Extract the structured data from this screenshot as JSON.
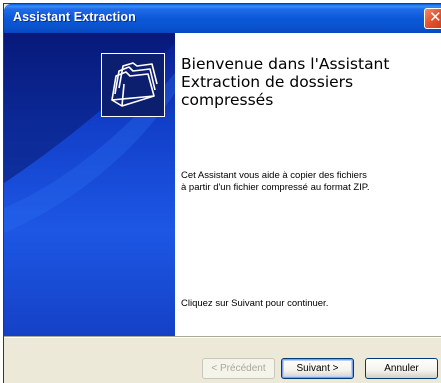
{
  "window": {
    "title": "Assistant Extraction",
    "close_icon": "close-icon"
  },
  "banner": {
    "icon": "compressed-folder-icon"
  },
  "content": {
    "heading": "Bienvenue dans l'Assistant Extraction de dossiers compressés",
    "description": "Cet Assistant vous aide à copier des fichiers à partir d'un fichier compressé au format ZIP.",
    "continue_text": "Cliquez sur Suivant pour continuer."
  },
  "buttons": {
    "previous": "< Précédent",
    "next": "Suivant >",
    "cancel": "Annuler"
  },
  "colors": {
    "titlebar": "#0a53cf",
    "banner": "#123fc9",
    "dialog_background": "#ece9d8",
    "close_button": "#e2562f"
  }
}
